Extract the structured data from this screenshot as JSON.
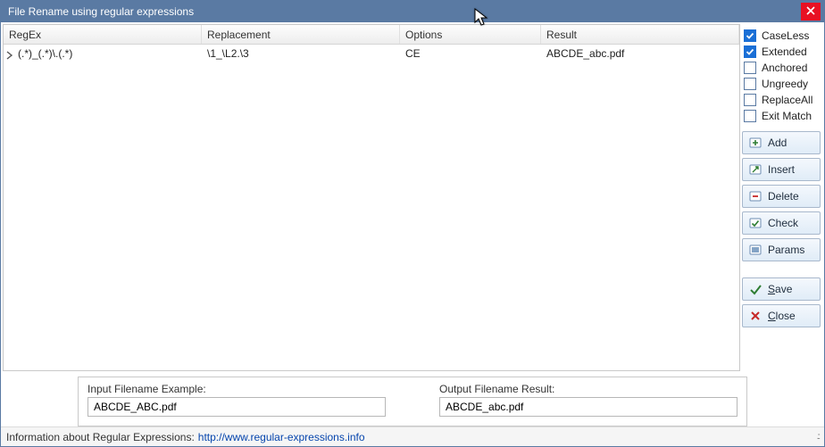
{
  "window": {
    "title": "File Rename using regular expressions"
  },
  "table": {
    "headers": {
      "regex": "RegEx",
      "replacement": "Replacement",
      "options": "Options",
      "result": "Result"
    },
    "rows": [
      {
        "regex": "(.*)_(.*)\\.(.*)",
        "replacement": "\\1_\\L2.\\3",
        "options": "CE",
        "result": "ABCDE_abc.pdf"
      }
    ]
  },
  "options": {
    "caseless": {
      "label": "CaseLess",
      "checked": true
    },
    "extended": {
      "label": "Extended",
      "checked": true
    },
    "anchored": {
      "label": "Anchored",
      "checked": false
    },
    "ungreedy": {
      "label": "Ungreedy",
      "checked": false
    },
    "replaceall": {
      "label": "ReplaceAll",
      "checked": false
    },
    "exitmatch": {
      "label": "Exit Match",
      "checked": false
    }
  },
  "buttons": {
    "add": "Add",
    "insert": "Insert",
    "delete": "Delete",
    "check": "Check",
    "params": "Params",
    "save": "ave",
    "save_mn": "S",
    "close": "lose",
    "close_mn": "C"
  },
  "example": {
    "input_label": "Input Filename Example:",
    "input_value": "ABCDE_ABC.pdf",
    "output_label": "Output Filename Result:",
    "output_value": "ABCDE_abc.pdf"
  },
  "footer": {
    "prefix": "Information about Regular Expressions: ",
    "link": "http://www.regular-expressions.info"
  }
}
